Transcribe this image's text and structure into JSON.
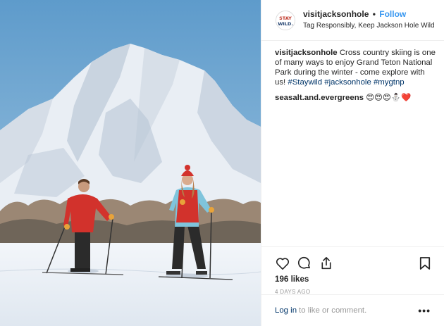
{
  "post": {
    "username": "visitjacksonhole",
    "follow_label": "Follow",
    "separator": "•",
    "location": "Tag Responsibly, Keep Jackson Hole Wild",
    "avatar_text_top": "STAY",
    "avatar_text_bottom": "WILD."
  },
  "caption": {
    "username": "visitjacksonhole",
    "text": "Cross country skiing is one of many ways to enjoy Grand Teton National Park during the winter - come explore with us! ",
    "hashtags": "#Staywild #jacksonhole #mygtnp"
  },
  "comment": {
    "username": "seasalt.and.evergreens",
    "text": "😍😍😍⛄❤️"
  },
  "actions": {
    "like_icon": "heart-icon",
    "comment_icon": "comment-icon",
    "share_icon": "share-icon",
    "save_icon": "bookmark-icon"
  },
  "stats": {
    "likes": "196 likes",
    "age": "4 DAYS AGO"
  },
  "footer": {
    "login_label": "Log in",
    "prompt": "to like or comment.",
    "more_label": "•••"
  },
  "colors": {
    "link_blue": "#3897f0",
    "hashtag_navy": "#003569",
    "muted_gray": "#999999",
    "border": "#efefef",
    "sky": "#6aa3cf",
    "jacket_red": "#d2322c"
  }
}
